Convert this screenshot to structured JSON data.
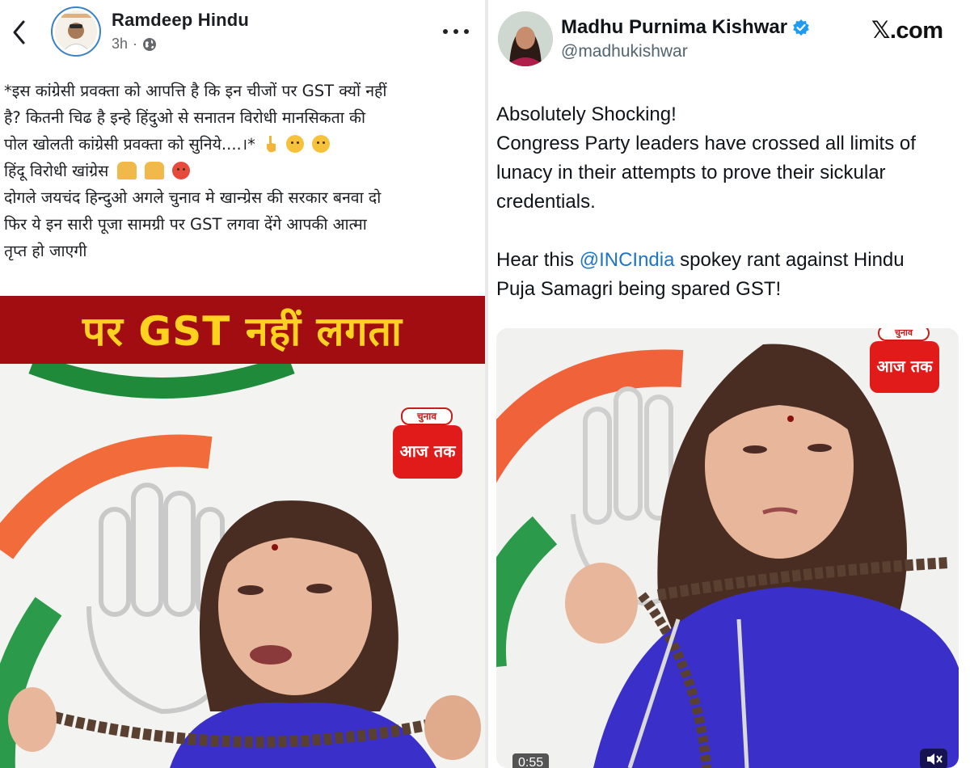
{
  "left_post": {
    "author_name": "Ramdeep Hindu",
    "time_ago": "3h",
    "visibility_separator": "·",
    "text_lines": [
      "*इस कांग्रेसी प्रवक्ता को आपत्ति है कि इन चीजों पर GST क्यों नहीं",
      "है? कितनी चिढ है इन्हे हिंदुओ से सनातन विरोधी मानसिकता की",
      "पोल खोलती कांग्रेसी प्रवक्ता को सुनिये....।*",
      "हिंदू विरोधी खांग्रेस",
      "दोगले जयचंद हिन्दुओ अगले चुनाव मे खान्ग्रेस की सरकार बनवा दो",
      "फिर ये इन सारी पूजा सामग्री पर GST लगवा देंगे आपकी आत्मा",
      "तृप्त हो जाएगी"
    ],
    "video": {
      "banner_text": "पर GST नहीं लगता",
      "channel_logo_top": "चुनाव",
      "channel_logo_main": "आज तक"
    }
  },
  "right_post": {
    "author_name": "Madhu Purnima Kishwar",
    "handle": "@madhukishwar",
    "site_logo": "𝕏.com",
    "text_line_1": "Absolutely Shocking!",
    "text_line_2": "Congress Party leaders have crossed all limits of",
    "text_line_3": "lunacy in their attempts to prove their sickular",
    "text_line_4": "credentials.",
    "text_line_5_prefix": "Hear this ",
    "mention": "@INCIndia",
    "text_line_5_suffix": " spokey rant against Hindu",
    "text_line_6": "Puja Samagri being spared GST!",
    "video": {
      "channel_logo_top": "चुनाव",
      "channel_logo_main": "आज तक",
      "time_badge": "0:55"
    }
  },
  "colors": {
    "banner_red": "#a10d10",
    "banner_yellow": "#ffd21f",
    "verified_blue": "#1d9bf0",
    "mention_blue": "#1d74c9",
    "saree_blue": "#3b2fc9"
  }
}
